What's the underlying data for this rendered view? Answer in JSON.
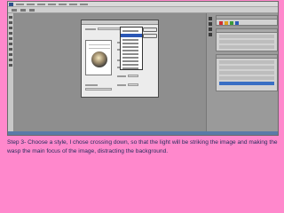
{
  "caption": {
    "text": "Step 3- Choose a style, I chose crossing down, so that the light will be striking the image and making the wasp the main focus of the image, distracting the background."
  },
  "screenshot": {
    "app": "photo-editor",
    "dialog": "lighting-effects",
    "dropdown_state": "open",
    "colors": {
      "slide_background": "#ff88cc",
      "caption_text": "#1f2a5a",
      "workspace": "#8e8e8e",
      "selection": "#2b57b5"
    }
  }
}
